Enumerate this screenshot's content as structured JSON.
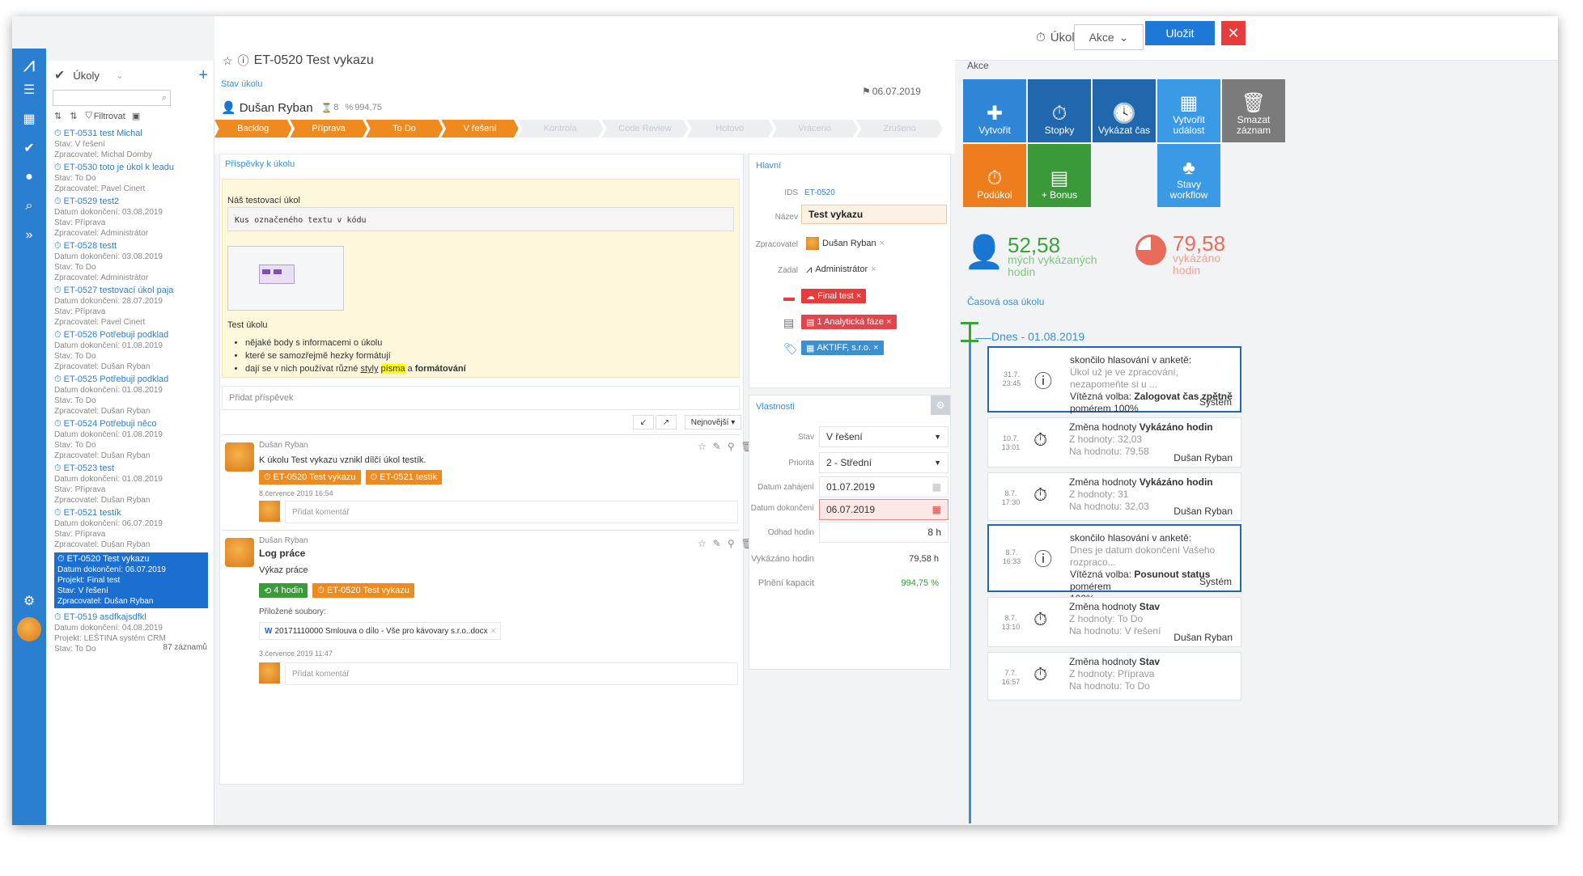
{
  "header": {
    "type_label": "Úkol",
    "actions_label": "Akce",
    "save_label": "Uložit",
    "title": "ET-0520 Test vykazu"
  },
  "sidebar": {
    "title": "Úkoly",
    "filter_label": "Filtrovat",
    "count": "87 záznamů",
    "tasks": [
      {
        "name": "ET-0531 test Michal",
        "l1": "Stav: V řešení",
        "l2": "Zpracovatel: Michal Domby",
        "l3": "",
        "l4": ""
      },
      {
        "name": "ET-0530 toto je úkol k leadu",
        "l1": "Stav: To Do",
        "l2": "Zpracovatel: Pavel Cinert",
        "l3": "",
        "l4": ""
      },
      {
        "name": "ET-0529 test2",
        "l1": "Datum dokončení: 03.08.2019",
        "l2": "Stav: Příprava",
        "l3": "Zpracovatel: Administrátor",
        "l4": ""
      },
      {
        "name": "ET-0528 testt",
        "l1": "Datum dokončení: 03.08.2019",
        "l2": "Stav: To Do",
        "l3": "Zpracovatel: Administrátor",
        "l4": ""
      },
      {
        "name": "ET-0527 testovací úkol paja",
        "l1": "Datum dokončení: 28.07.2019",
        "l2": "Stav: Příprava",
        "l3": "Zpracovatel: Pavel Cinert",
        "l4": ""
      },
      {
        "name": "ET-0526 Potřebuji podklad",
        "l1": "Datum dokončení: 01.08.2019",
        "l2": "Stav: To Do",
        "l3": "Zpracovatel: Dušan Ryban",
        "l4": ""
      },
      {
        "name": "ET-0525 Potřebuji podklad",
        "l1": "Datum dokončení: 01.08.2019",
        "l2": "Stav: To Do",
        "l3": "Zpracovatel: Dušan Ryban",
        "l4": ""
      },
      {
        "name": "ET-0524 Potřebuji něco",
        "l1": "Datum dokončení: 01.08.2019",
        "l2": "Stav: To Do",
        "l3": "Zpracovatel: Dušan Ryban",
        "l4": ""
      },
      {
        "name": "ET-0523 test",
        "l1": "Datum dokončení: 01.08.2019",
        "l2": "Stav: Příprava",
        "l3": "Zpracovatel: Dušan Ryban",
        "l4": ""
      },
      {
        "name": "ET-0521 testík",
        "l1": "Datum dokončení: 06.07.2019",
        "l2": "Stav: Příprava",
        "l3": "Zpracovatel: Dušan Ryban",
        "l4": ""
      },
      {
        "name": "ET-0520 Test vykazu",
        "l1": "Datum dokončení: 06.07.2019",
        "l2": "Projekt: Final test",
        "l3": "Stav: V řešení",
        "l4": "Zpracovatel: Dušan Ryban"
      },
      {
        "name": "ET-0519 asdfkajsdfkl",
        "l1": "Datum dokončení: 04.08.2019",
        "l2": "Projekt: LEŠTINA systém CRM",
        "l3": "Stav: To Do",
        "l4": ""
      }
    ]
  },
  "task": {
    "assignee": "Dušan Ryban",
    "hours": "8",
    "percent": "994,75",
    "date": "06.07.2019",
    "status_label": "Stav úkolu"
  },
  "stages": [
    "Backlog",
    "Příprava",
    "To Do",
    "V řešení",
    "Kontrola",
    "Code Review",
    "Hotovo",
    "Vráceno",
    "Zrušeno"
  ],
  "posts": {
    "title": "Příspěvky k úkolu",
    "intro": "Náš testovací úkol",
    "code": "Kus označeného textu v kódu",
    "test_label": "Test úkolu",
    "bullets": [
      "nějaké body s informacemi o úkolu",
      "které se samozřejmě hezky formátují"
    ],
    "bullet3_a": "dají se v nich používat různé ",
    "bullet3_b": "styly",
    "bullet3_c": " ",
    "bullet3_d": "písma",
    "bullet3_e": " a ",
    "bullet3_f": "formátování",
    "add_post": "Přidat příspěvek",
    "sort": "Nejnovější",
    "p1_author": "Dušan Ryban",
    "p1_text": "K úkolu Test vykazu vznikl dílčí úkol testík.",
    "p1_tag1": "ET-0520 Test vykazu",
    "p1_tag2": "ET-0521 testík",
    "p1_date": "8.července 2019 16:54",
    "comment_ph": "Přidat komentář",
    "p2_author": "Dušan Ryban",
    "p2_title": "Log práce",
    "p2_text": "Výkaz práce",
    "p2_tag1": "4 hodin",
    "p2_tag2": "ET-0520 Test vykazu",
    "p2_attach": "Přiložené soubory:",
    "p2_file": "20171110000 Smlouva o dílo - Vše pro kávovary s.r.o..docx",
    "p2_date": "3.července 2019 11:47"
  },
  "main": {
    "title": "Hlavní",
    "ids_label": "IDS",
    "ids": "ET-0520",
    "name_label": "Název",
    "name": "Test vykazu",
    "assignee_label": "Zpracovatel",
    "assignee": "Dušan Ryban",
    "author_label": "Zadal",
    "author": "Administrátor",
    "project": "Final test",
    "phase": "1 Analytická fáze",
    "company": "AKTIFF, s.r.o."
  },
  "props": {
    "title": "Vlastnosti",
    "status_label": "Stav",
    "status": "V řešení",
    "priority_label": "Priorita",
    "priority": "2 - Střední",
    "start_label": "Datum zahájení",
    "start": "01.07.2019",
    "end_label": "Datum dokončení",
    "end": "06.07.2019",
    "est_label": "Odhad hodin",
    "est": "8 h",
    "logged_label": "Vykázáno hodin",
    "logged": "79,58 h",
    "cap_label": "Plnění kapacit",
    "cap": "994,75 %"
  },
  "actions": {
    "title": "Akce",
    "items": [
      "Vytvořit",
      "Stopky",
      "Vykázat čas",
      "Vytvořit událost",
      "Smazat záznam",
      "Podúkol",
      "+ Bonus",
      "Stavy workflow"
    ]
  },
  "stats": {
    "my_value": "52,58",
    "my_label": "mých vykázaných hodin",
    "total_value": "79,58",
    "total_label": "vykázáno hodin"
  },
  "timeline": {
    "title": "Časová osa úkolu",
    "today": "Dnes - 01.08.2019",
    "e1": {
      "date": "31.7.",
      "time": "23:45",
      "l1": "skončilo hlasování v anketě:",
      "l2": "Úkol už je ve zpracování, nezapomeňte si u ...",
      "l3a": "Vítězná volba: ",
      "l3b": "Zalogovat čas zpětně",
      "l4": "pomérem 100%",
      "by": "Systém"
    },
    "e2": {
      "date": "10.7.",
      "time": "13:01",
      "l1a": "Změna hodnoty ",
      "l1b": "Vykázáno hodin",
      "l2": "Z hodnoty: 32,03",
      "l3": "Na hodnotu: 79,58",
      "by": "Dušan Ryban"
    },
    "e3": {
      "date": "8.7.",
      "time": "17:30",
      "l1a": "Změna hodnoty ",
      "l1b": "Vykázáno hodin",
      "l2": "Z hodnoty: 31",
      "l3": "Na hodnotu: 32,03",
      "by": "Dušan Ryban"
    },
    "e4": {
      "date": "8.7.",
      "time": "16:33",
      "l1": "skončilo hlasování v anketě:",
      "l2": "Dnes je datum dokončení Vašeho rozpraco...",
      "l3a": "Vítězná volba: ",
      "l3b": "Posunout status",
      "l3c": " pomérem",
      "l4": "100%",
      "by": "Systém"
    },
    "e5": {
      "date": "8.7.",
      "time": "13:10",
      "l1a": "Změna hodnoty ",
      "l1b": "Stav",
      "l2": "Z hodnoty: To Do",
      "l3": "Na hodnotu: V řešení",
      "by": "Dušan Ryban"
    },
    "e6": {
      "date": "7.7.",
      "time": "16:57",
      "l1a": "Změna hodnoty ",
      "l1b": "Stav",
      "l2": "Z hodnoty: Příprava",
      "l3": "Na hodnotu: To Do",
      "by": ""
    }
  }
}
